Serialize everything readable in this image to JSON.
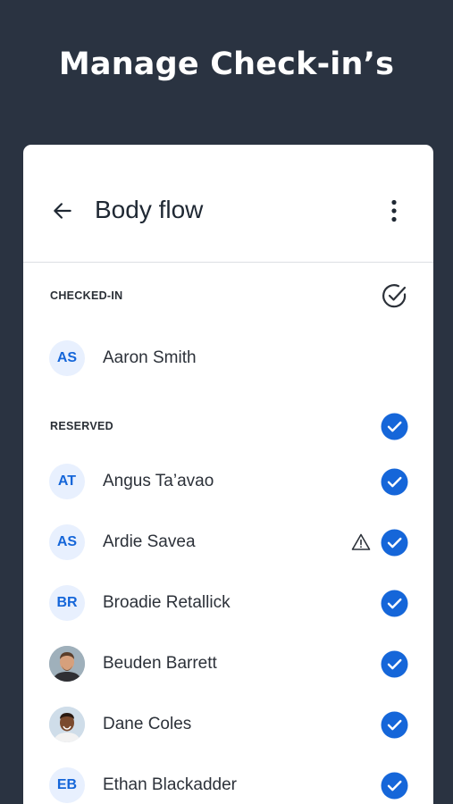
{
  "headline": "Manage Check-in’s",
  "appbar": {
    "title": "Body flow",
    "back_icon": "arrow-left-icon",
    "menu_icon": "more-vertical-icon"
  },
  "colors": {
    "background": "#2a3341",
    "accent": "#1566d9",
    "avatar_bg": "#e8f0fe"
  },
  "sections": {
    "checked_in": {
      "label": "CHECKED-IN",
      "icon": "check-circle-outline-icon",
      "people": [
        {
          "initials": "AS",
          "name": "Aaron Smith"
        }
      ]
    },
    "reserved": {
      "label": "RESERVED",
      "icon": "check-circle-filled-icon",
      "people": [
        {
          "initials": "AT",
          "name": "Angus Ta’avao"
        },
        {
          "initials": "AS",
          "name": "Ardie Savea",
          "warning_icon": "warning-triangle-icon"
        },
        {
          "initials": "BR",
          "name": "Broadie Retallick"
        },
        {
          "initials": "",
          "name": "Beuden Barrett",
          "photo": "person-photo-icon"
        },
        {
          "initials": "",
          "name": "Dane Coles",
          "photo": "person-photo-icon"
        },
        {
          "initials": "EB",
          "name": "Ethan Blackadder"
        }
      ]
    }
  }
}
